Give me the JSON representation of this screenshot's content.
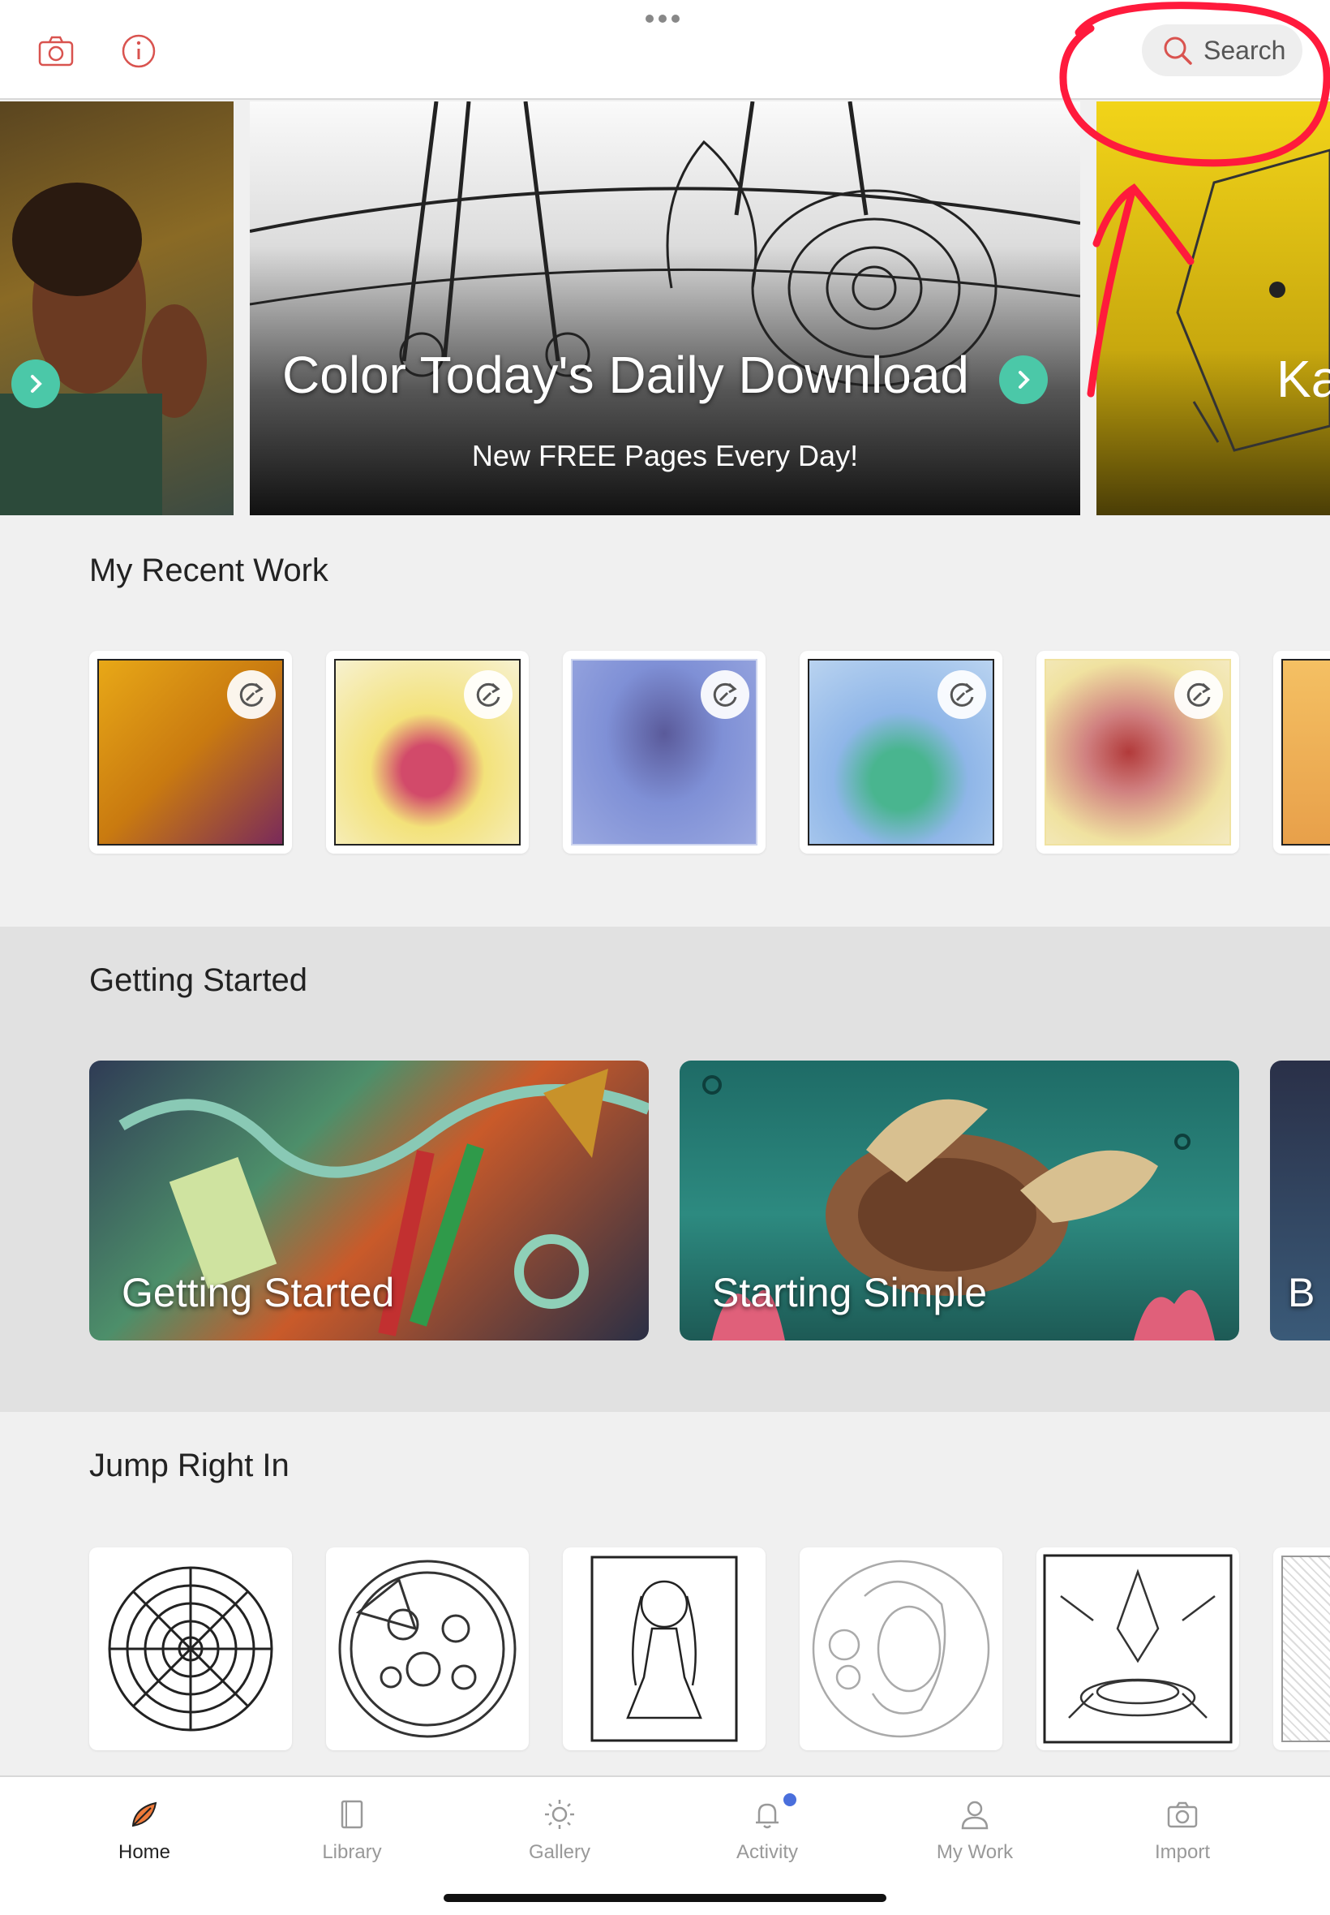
{
  "topbar": {
    "search_label": "Search",
    "icons": [
      "camera-icon",
      "info-icon",
      "more-dots-icon",
      "search-icon"
    ]
  },
  "banner": {
    "title": "Color Today's Daily Download",
    "subtitle": "New FREE Pages Every Day!",
    "next_peek_text": "Ka"
  },
  "recent": {
    "title": "My Recent Work",
    "items": [
      {
        "colors": [
          "#e8a817",
          "#7a2a5a"
        ]
      },
      {
        "colors": [
          "#f3e27a",
          "#d24a6a"
        ]
      },
      {
        "colors": [
          "#7f90d6",
          "#5a5a9a"
        ]
      },
      {
        "colors": [
          "#8fb6e8",
          "#49b58f"
        ]
      },
      {
        "colors": [
          "#f0e2a0",
          "#b23a3a"
        ]
      }
    ]
  },
  "getting_started": {
    "title": "Getting Started",
    "cards": [
      {
        "label": "Getting Started",
        "colors": [
          "#2f3b55",
          "#c95a2a",
          "#4d8f6a"
        ]
      },
      {
        "label": "Starting Simple",
        "colors": [
          "#1e6b66",
          "#2d8a80",
          "#8a5a3a"
        ]
      },
      {
        "label": "B",
        "colors": [
          "#2a3048",
          "#3a5a78",
          "#24a05a"
        ]
      }
    ]
  },
  "jump_in": {
    "title": "Jump Right In",
    "items": [
      "mandala",
      "pizza",
      "anime-girl",
      "woman-portrait",
      "fantasy-scene",
      "floral"
    ]
  },
  "tabs": [
    {
      "label": "Home",
      "icon": "home-leaf-icon",
      "active": true
    },
    {
      "label": "Library",
      "icon": "library-icon",
      "active": false
    },
    {
      "label": "Gallery",
      "icon": "gallery-sun-icon",
      "active": false
    },
    {
      "label": "Activity",
      "icon": "bell-icon",
      "active": false
    },
    {
      "label": "My Work",
      "icon": "person-icon",
      "active": false
    },
    {
      "label": "Import",
      "icon": "camera-icon",
      "active": false
    }
  ],
  "colors": {
    "accent_red": "#d9534f",
    "arrow_teal": "#4bc8a8",
    "annotation_red": "#ff1a3c",
    "notification_dot": "#4a6fdc"
  }
}
